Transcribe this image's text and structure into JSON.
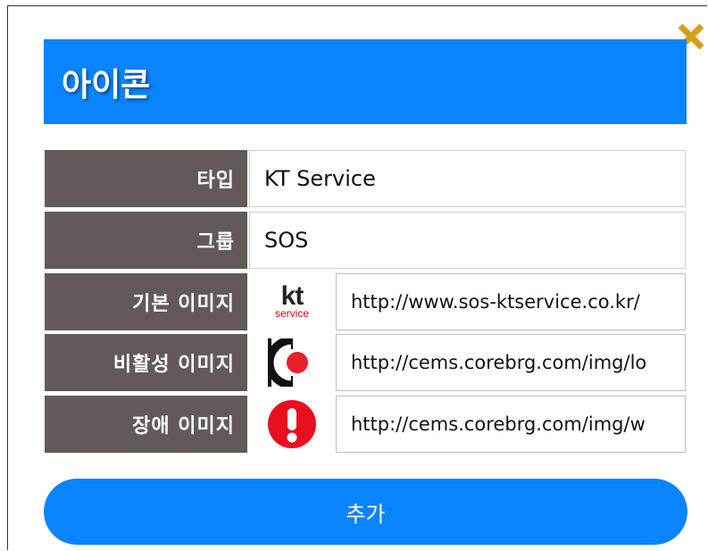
{
  "dialog": {
    "title": "아이콘",
    "close_icon": "close-x-icon",
    "close_color": "#d4a017",
    "accent_color": "#0a84ff",
    "label_bg_color": "#625a58"
  },
  "fields": {
    "type": {
      "label": "타입",
      "value": "KT Service"
    },
    "group": {
      "label": "그룹",
      "value": "SOS"
    },
    "default_image": {
      "label": "기본 이미지",
      "icon": "kt-service-logo-icon",
      "logo_text": "kt",
      "logo_subtext": "service",
      "url": "http://www.sos-ktservice.co.kr/"
    },
    "inactive_image": {
      "label": "비활성 이미지",
      "icon": "inactive-status-icon",
      "url": "http://cems.corebrg.com/img/lo"
    },
    "fault_image": {
      "label": "장애 이미지",
      "icon": "fault-alert-icon",
      "url": "http://cems.corebrg.com/img/w"
    }
  },
  "actions": {
    "add_label": "추가"
  }
}
